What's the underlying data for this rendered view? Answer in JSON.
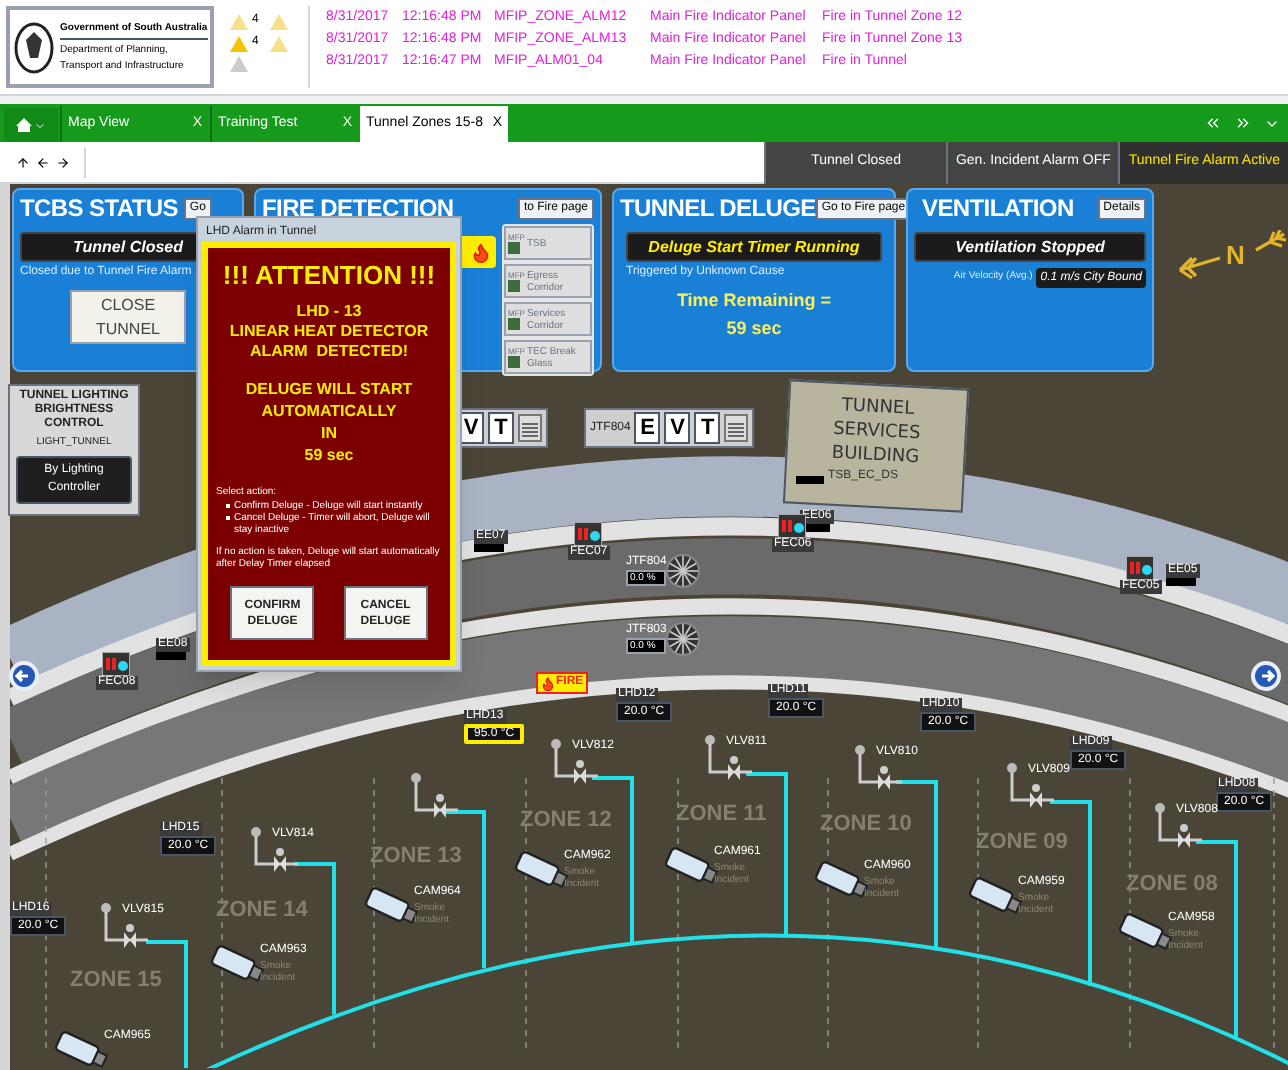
{
  "header": {
    "org_lines": [
      "Government of South Australia",
      "Department of Planning,",
      "Transport and Infrastructure"
    ],
    "alarm_counts": [
      "4",
      "4"
    ]
  },
  "alarms": [
    {
      "date": "8/31/2017",
      "time": "12:16:48 PM",
      "tag": "MFIP_ZONE_ALM12",
      "source": "Main Fire Indicator Panel",
      "message": "Fire in Tunnel Zone 12"
    },
    {
      "date": "8/31/2017",
      "time": "12:16:48 PM",
      "tag": "MFIP_ZONE_ALM13",
      "source": "Main Fire Indicator Panel",
      "message": "Fire in Tunnel Zone 13"
    },
    {
      "date": "8/31/2017",
      "time": "12:16:47 PM",
      "tag": "MFIP_ALM01_04",
      "source": "Main Fire Indicator Panel",
      "message": "Fire in Tunnel"
    }
  ],
  "tabs": [
    {
      "label": "Map View",
      "close": "X",
      "selected": false
    },
    {
      "label": "Training Test",
      "close": "X",
      "selected": false
    },
    {
      "label": "Tunnel Zones 15-8",
      "close": "X",
      "selected": true
    }
  ],
  "status_indicators": [
    {
      "label": "Tunnel Closed",
      "active": false
    },
    {
      "label": "Gen. Incident Alarm OFF",
      "active": false
    },
    {
      "label": "Tunnel Fire Alarm Active",
      "active": true
    }
  ],
  "tcbs": {
    "title": "TCBS STATUS",
    "button": "Go",
    "status": "Tunnel Closed",
    "note": "Closed due to Tunnel Fire Alarm",
    "action": "CLOSE TUNNEL"
  },
  "fire_detection": {
    "title": "FIRE DETECTION",
    "button": "to Fire page",
    "alarm": true,
    "mfp": [
      {
        "tag": "MFP",
        "label": "TSB"
      },
      {
        "tag": "MFP",
        "label": "Egress Corridor"
      },
      {
        "tag": "MFP",
        "label": "Services Corridor"
      },
      {
        "tag": "MFP",
        "label": "TEC Break Glass"
      }
    ]
  },
  "deluge": {
    "title": "TUNNEL DELUGE",
    "button": "Go to Fire page",
    "status": "Deluge Start Timer Running",
    "note": "Triggered by Unknown Cause",
    "timer_label": "Time Remaining =",
    "timer_value": "59 sec"
  },
  "ventilation": {
    "title": "VENTILATION",
    "button": "Details",
    "status": "Ventilation Stopped",
    "velocity_label": "Air Velocity (Avg.)",
    "velocity": "0.1 m/s City Bound"
  },
  "lighting": {
    "title": "TUNNEL LIGHTING BRIGHTNESS CONTROL",
    "tag": "LIGHT_TUNNEL",
    "mode": "By Lighting Controller"
  },
  "compass": "N",
  "building": {
    "name": "TUNNEL SERVICES BUILDING",
    "tag": "TSB_EC_DS"
  },
  "evt_panels": [
    {
      "keys": [
        "V",
        "T"
      ]
    },
    {
      "tag": "JTF804",
      "keys": [
        "E",
        "V",
        "T"
      ]
    }
  ],
  "equipment": [
    {
      "kind": "ee",
      "label": "EE07"
    },
    {
      "kind": "fec",
      "label": "FEC07"
    },
    {
      "kind": "jtf",
      "label": "JTF804",
      "reading": "0.0 %"
    },
    {
      "kind": "jtf",
      "label": "JTF803",
      "reading": "0.0 %"
    },
    {
      "kind": "ee",
      "label": "EE06"
    },
    {
      "kind": "fec",
      "label": "FEC06"
    },
    {
      "kind": "ee",
      "label": "EE05"
    },
    {
      "kind": "fec",
      "label": "FEC05"
    },
    {
      "kind": "ee",
      "label": "EE08"
    },
    {
      "kind": "fec",
      "label": "FEC08"
    },
    {
      "kind": "fire",
      "label": "FIRE"
    }
  ],
  "zones": [
    "ZONE 15",
    "ZONE 14",
    "ZONE 13",
    "ZONE 12",
    "ZONE 11",
    "ZONE 10",
    "ZONE 09",
    "ZONE 08"
  ],
  "detectors": [
    {
      "label": "LHD16",
      "reading": "20.0 °C",
      "alarm": false
    },
    {
      "label": "LHD15",
      "reading": "20.0 °C",
      "alarm": false
    },
    {
      "label": "LHD13",
      "reading": "95.0 °C",
      "alarm": true
    },
    {
      "label": "LHD12",
      "reading": "20.0 °C",
      "alarm": false
    },
    {
      "label": "LHD11",
      "reading": "20.0 °C",
      "alarm": false
    },
    {
      "label": "LHD10",
      "reading": "20.0 °C",
      "alarm": false
    },
    {
      "label": "LHD09",
      "reading": "20.0 °C",
      "alarm": false
    },
    {
      "label": "LHD08",
      "reading": "20.0 °C",
      "alarm": false
    }
  ],
  "valves": [
    "VLV815",
    "VLV814",
    "VLV812",
    "VLV811",
    "VLV810",
    "VLV809",
    "VLV808"
  ],
  "cameras": [
    {
      "label": "CAM965"
    },
    {
      "label": "CAM963",
      "incident": "Smoke Incident"
    },
    {
      "label": "CAM964",
      "incident": "Smoke Incident"
    },
    {
      "label": "CAM962",
      "incident": "Smoke Incident"
    },
    {
      "label": "CAM961",
      "incident": "Smoke Incident"
    },
    {
      "label": "CAM960",
      "incident": "Smoke Incident"
    },
    {
      "label": "CAM959",
      "incident": "Smoke Incident"
    },
    {
      "label": "CAM958",
      "incident": "Smoke Incident"
    }
  ],
  "popup": {
    "title": "LHD Alarm in Tunnel",
    "heading": "!!! ATTENTION !!!",
    "message": [
      "LHD - 13",
      "LINEAR HEAT DETECTOR",
      "ALARM  DETECTED!"
    ],
    "countdown": [
      "DELUGE WILL START",
      "AUTOMATICALLY",
      "IN",
      "59 sec"
    ],
    "prompt": "Select action:",
    "options": [
      "Confirm Deluge - Deluge will start instantly",
      "Cancel Deluge - Timer will abort, Deluge will stay inactive"
    ],
    "note": "If no action is taken, Deluge will start automatically after Delay Timer elapsed",
    "buttons": [
      "CONFIRM DELUGE",
      "CANCEL DELUGE"
    ]
  }
}
